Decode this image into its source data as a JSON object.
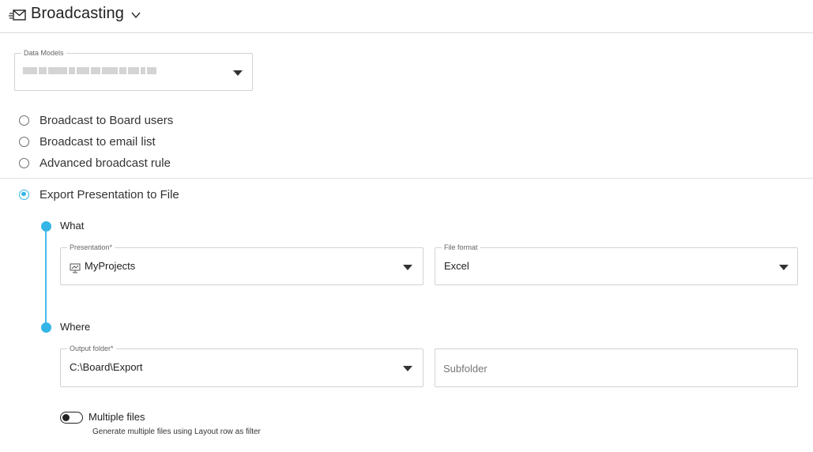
{
  "header": {
    "title": "Broadcasting",
    "icon": "envelope-icon",
    "dropdown_icon": "chevron-down-icon"
  },
  "data_models": {
    "label": "Data Models",
    "value_obscured": true
  },
  "broadcast_options": [
    {
      "label": "Broadcast to Board users",
      "selected": false
    },
    {
      "label": "Broadcast to email list",
      "selected": false
    },
    {
      "label": "Advanced broadcast rule",
      "selected": false
    },
    {
      "label": "Export Presentation to File",
      "selected": true
    }
  ],
  "steps": {
    "what": {
      "title": "What",
      "presentation": {
        "label": "Presentation*",
        "value": "MyProjects",
        "icon": "presentation-icon"
      },
      "file_format": {
        "label": "File format",
        "value": "Excel"
      }
    },
    "where": {
      "title": "Where",
      "output_folder": {
        "label": "Output folder*",
        "value": "C:\\Board\\Export"
      },
      "subfolder": {
        "placeholder": "Subfolder",
        "value": ""
      }
    }
  },
  "multiple_files": {
    "label": "Multiple files",
    "description": "Generate multiple files using Layout row as filter",
    "enabled": false
  },
  "colors": {
    "accent": "#33b5e5",
    "border": "#d2d2d2",
    "text": "#333333"
  }
}
